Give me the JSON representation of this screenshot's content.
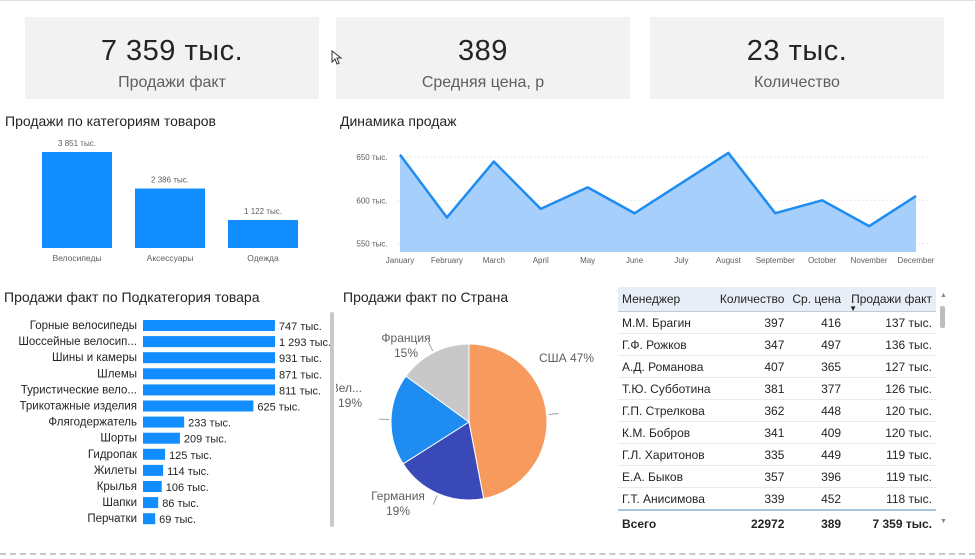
{
  "kpis": [
    {
      "value": "7 359 тыс.",
      "label": "Продажи факт"
    },
    {
      "value": "389",
      "label": "Средняя цена, р"
    },
    {
      "value": "23 тыс.",
      "label": "Количество"
    }
  ],
  "colors": {
    "bar": "#118dff",
    "area_line": "#1e8cf0",
    "area_fill": "#a6d0fb"
  },
  "chart_data": [
    {
      "type": "bar",
      "title": "Продажи по категориям товаров",
      "categories": [
        "Велосипеды",
        "Аксессуары",
        "Одежда"
      ],
      "values": [
        3851,
        2386,
        1122
      ],
      "data_labels": [
        "3 851 тыс.",
        "2 386 тыс.",
        "1 122 тыс."
      ],
      "ylim": [
        0,
        3851
      ]
    },
    {
      "type": "area",
      "title": "Динамика продаж",
      "categories": [
        "January",
        "February",
        "March",
        "April",
        "May",
        "June",
        "July",
        "August",
        "September",
        "October",
        "November",
        "December"
      ],
      "values": [
        653,
        580,
        645,
        590,
        615,
        585,
        620,
        655,
        585,
        600,
        570,
        605
      ],
      "yticks": [
        550,
        600,
        650
      ],
      "ytick_labels": [
        "550 тыс.",
        "600 тыс.",
        "650 тыс."
      ],
      "ylim": [
        540,
        670
      ],
      "grid": true
    },
    {
      "type": "bar",
      "orientation": "horizontal",
      "title": "Продажи факт по Подкатегория товара",
      "categories": [
        "Горные велосипеды",
        "Шоссейные велосип...",
        "Шины и камеры",
        "Шлемы",
        "Туристические вело...",
        "Трикотажные изделия",
        "Флягодержатель",
        "Шорты",
        "Гидропак",
        "Жилеты",
        "Крылья",
        "Шапки",
        "Перчатки"
      ],
      "values": [
        747,
        1293,
        931,
        871,
        811,
        625,
        233,
        209,
        125,
        114,
        106,
        86,
        69
      ],
      "data_labels": [
        "747 тыс.",
        "1 293 тыс.",
        "931 тыс.",
        "871 тыс.",
        "811 тыс.",
        "625 тыс.",
        "233 тыс.",
        "209 тыс.",
        "125 тыс.",
        "114 тыс.",
        "106 тыс.",
        "86 тыс.",
        "69 тыс."
      ]
    },
    {
      "type": "pie",
      "title": "Продажи факт по Страна",
      "slices": [
        {
          "label": "США",
          "percent_label": "47%",
          "value": 47,
          "color": "#f79a5e"
        },
        {
          "label": "Германия",
          "percent_label": "19%",
          "value": 19,
          "color": "#3a49b8"
        },
        {
          "label": "Вел...",
          "percent_label": "19%",
          "value": 19,
          "color": "#1e8cf0"
        },
        {
          "label": "Франция",
          "percent_label": "15%",
          "value": 15,
          "color": "#c8c8c8"
        }
      ]
    }
  ],
  "table": {
    "headers": [
      "Менеджер",
      "Количество",
      "Ср. цена",
      "Продажи факт"
    ],
    "sort_indicator": "▼",
    "rows": [
      [
        "М.М. Брагин",
        "397",
        "416",
        "137 тыс."
      ],
      [
        "Г.Ф. Рожков",
        "347",
        "497",
        "136 тыс."
      ],
      [
        "А.Д. Романова",
        "407",
        "365",
        "127 тыс."
      ],
      [
        "Т.Ю. Субботина",
        "381",
        "377",
        "126 тыс."
      ],
      [
        "Г.П. Стрелкова",
        "362",
        "448",
        "120 тыс."
      ],
      [
        "К.М. Бобров",
        "341",
        "409",
        "120 тыс."
      ],
      [
        "Г.Л. Харитонов",
        "335",
        "449",
        "119 тыс."
      ],
      [
        "Е.А. Быков",
        "357",
        "396",
        "119 тыс."
      ],
      [
        "Г.Т. Анисимова",
        "339",
        "452",
        "118 тыс."
      ]
    ],
    "total": [
      "Всего",
      "22972",
      "389",
      "7 359 тыс."
    ]
  }
}
